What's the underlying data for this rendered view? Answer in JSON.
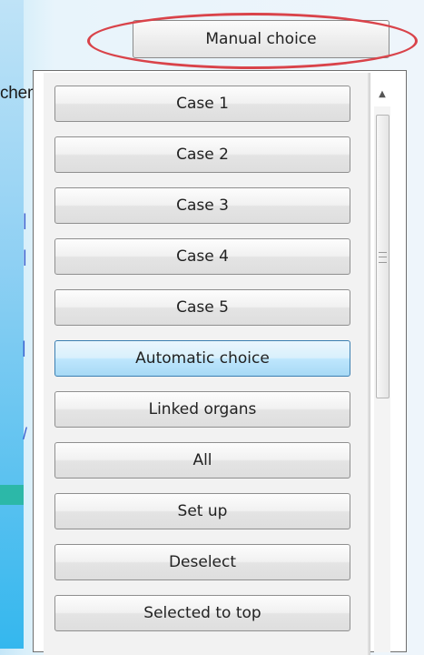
{
  "background_text": "chema. Kan vooraf een",
  "manual_choice": {
    "label": "Manual choice"
  },
  "menu": {
    "items": [
      {
        "label": "Case 1",
        "active": false
      },
      {
        "label": "Case 2",
        "active": false
      },
      {
        "label": "Case 3",
        "active": false
      },
      {
        "label": "Case 4",
        "active": false
      },
      {
        "label": "Case 5",
        "active": false
      },
      {
        "label": "Automatic choice",
        "active": true
      },
      {
        "label": "Linked organs",
        "active": false
      },
      {
        "label": "All",
        "active": false
      },
      {
        "label": "Set up",
        "active": false
      },
      {
        "label": "Deselect",
        "active": false
      },
      {
        "label": "Selected to top",
        "active": false
      }
    ]
  },
  "colors": {
    "highlight_ellipse": "#d9434a",
    "active_button": "#bee6fd"
  }
}
